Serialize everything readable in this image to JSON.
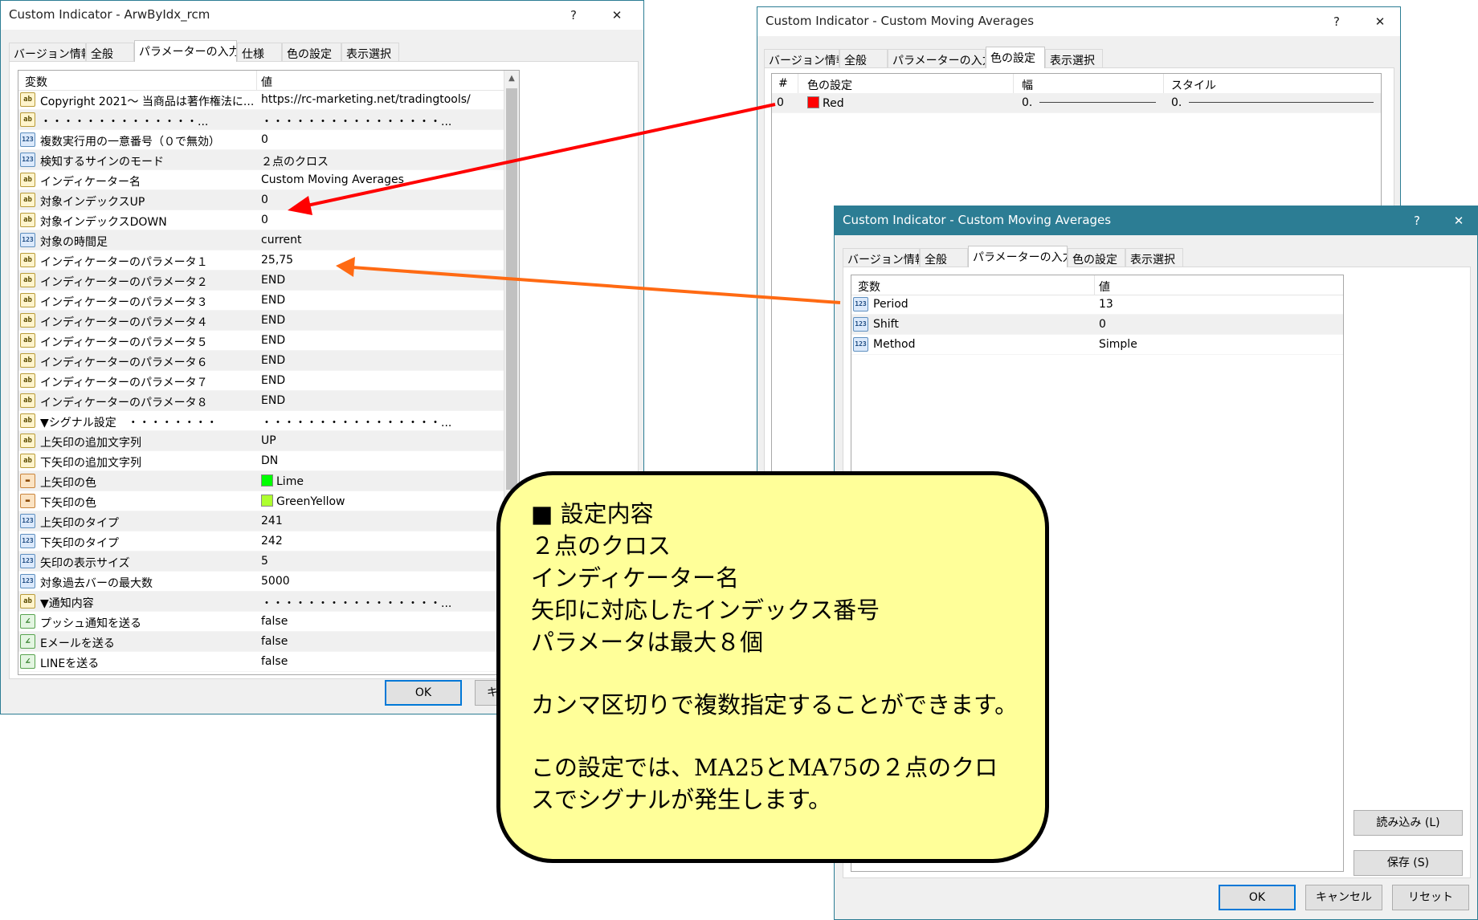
{
  "win1": {
    "title": "Custom Indicator - ArwByIdx_rcm",
    "help": "?",
    "close": "✕",
    "tabs": [
      "バージョン情報",
      "全般",
      "パラメーターの入力",
      "仕様",
      "色の設定",
      "表示選択"
    ],
    "selected_tab": 2,
    "headers": {
      "var": "変数",
      "val": "値"
    },
    "rows": [
      {
        "icon": "ab",
        "name": "Copyright 2021～ 当商品は著作権法に...",
        "value": "https://rc-marketing.net/tradingtools/"
      },
      {
        "icon": "ab",
        "name": "・・・・・・・・・・・・・・...",
        "value": "・・・・・・・・・・・・・・・・..."
      },
      {
        "icon": "123",
        "name": "複数実行用の一意番号（０で無効）",
        "value": "0"
      },
      {
        "icon": "123",
        "name": "検知するサインのモード",
        "value": "２点のクロス"
      },
      {
        "icon": "ab",
        "name": "インディケーター名",
        "value": "Custom Moving Averages"
      },
      {
        "icon": "ab",
        "name": "対象インデックスUP",
        "value": "0"
      },
      {
        "icon": "ab",
        "name": "対象インデックスDOWN",
        "value": "0"
      },
      {
        "icon": "123",
        "name": "対象の時間足",
        "value": "current"
      },
      {
        "icon": "ab",
        "name": "インディケーターのパラメータ１",
        "value": "25,75"
      },
      {
        "icon": "ab",
        "name": "インディケーターのパラメータ２",
        "value": "END"
      },
      {
        "icon": "ab",
        "name": "インディケーターのパラメータ３",
        "value": "END"
      },
      {
        "icon": "ab",
        "name": "インディケーターのパラメータ４",
        "value": "END"
      },
      {
        "icon": "ab",
        "name": "インディケーターのパラメータ５",
        "value": "END"
      },
      {
        "icon": "ab",
        "name": "インディケーターのパラメータ６",
        "value": "END"
      },
      {
        "icon": "ab",
        "name": "インディケーターのパラメータ７",
        "value": "END"
      },
      {
        "icon": "ab",
        "name": "インディケーターのパラメータ８",
        "value": "END"
      },
      {
        "icon": "ab",
        "name": "▼シグナル設定　・・・・・・・・",
        "value": "・・・・・・・・・・・・・・・・..."
      },
      {
        "icon": "ab",
        "name": "上矢印の追加文字列",
        "value": "UP"
      },
      {
        "icon": "ab",
        "name": "下矢印の追加文字列",
        "value": "DN"
      },
      {
        "icon": "clr",
        "name": "上矢印の色",
        "value": "Lime",
        "swatch": "#00ff00"
      },
      {
        "icon": "clr",
        "name": "下矢印の色",
        "value": "GreenYellow",
        "swatch": "#adff2f"
      },
      {
        "icon": "123",
        "name": "上矢印のタイプ",
        "value": "241"
      },
      {
        "icon": "123",
        "name": "下矢印のタイプ",
        "value": "242"
      },
      {
        "icon": "123",
        "name": "矢印の表示サイズ",
        "value": "5"
      },
      {
        "icon": "123",
        "name": "対象過去バーの最大数",
        "value": "5000"
      },
      {
        "icon": "ab",
        "name": "▼通知内容",
        "value": "・・・・・・・・・・・・・・・・..."
      },
      {
        "icon": "bool",
        "name": "プッシュ通知を送る",
        "value": "false"
      },
      {
        "icon": "bool",
        "name": "Eメールを送る",
        "value": "false"
      },
      {
        "icon": "bool",
        "name": "LINEを送る",
        "value": "false"
      }
    ],
    "ok": "OK",
    "cancel_partial": "キ"
  },
  "win2": {
    "title": "Custom Indicator - Custom Moving Averages",
    "help": "?",
    "close": "✕",
    "tabs": [
      "バージョン情報",
      "全般",
      "パラメーターの入力",
      "色の設定",
      "表示選択"
    ],
    "selected_tab": 3,
    "headers": {
      "num": "#",
      "color": "色の設定",
      "width": "幅",
      "style": "スタイル"
    },
    "rows": [
      {
        "num": "0",
        "color": "Red",
        "swatch": "#ff0000",
        "width": "0.",
        "style": "0."
      }
    ]
  },
  "win3": {
    "title": "Custom Indicator - Custom Moving Averages",
    "help": "?",
    "close": "✕",
    "tabs": [
      "バージョン情報",
      "全般",
      "パラメーターの入力",
      "色の設定",
      "表示選択"
    ],
    "selected_tab": 2,
    "headers": {
      "var": "変数",
      "val": "値"
    },
    "rows": [
      {
        "icon": "123",
        "name": "Period",
        "value": "13"
      },
      {
        "icon": "123",
        "name": "Shift",
        "value": "0"
      },
      {
        "icon": "123",
        "name": "Method",
        "value": "Simple"
      }
    ],
    "load": "読み込み (L)",
    "save": "保存 (S)",
    "ok": "OK",
    "cancel": "キャンセル",
    "reset": "リセット"
  },
  "callout": {
    "lines": [
      "■ 設定内容",
      "２点のクロス",
      "インディケーター名",
      "矢印に対応したインデックス番号",
      "パラメータは最大８個",
      "カンマ区切りで複数指定することができます。",
      "この設定では、MA25とMA75の２点のクロスでシグナルが発生します。"
    ]
  },
  "colors": {
    "title_active": "#2c7d94",
    "arrow_red": "#ff0000",
    "arrow_orange": "#ff6a13",
    "callout_fill": "#ffff99"
  }
}
